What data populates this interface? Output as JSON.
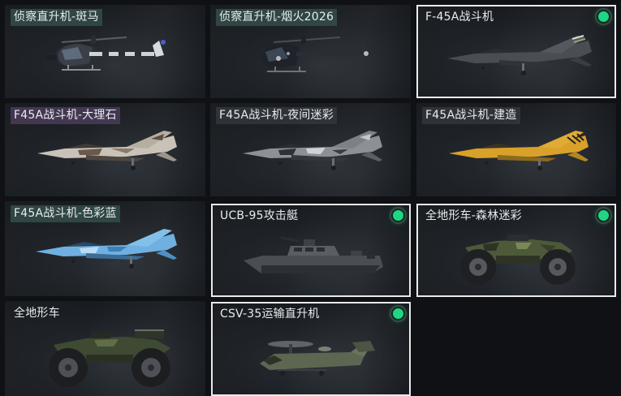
{
  "cards": [
    {
      "title": "侦察直升机-斑马",
      "selected": false,
      "equipped": false
    },
    {
      "title": "侦察直升机-烟火2026",
      "selected": false,
      "equipped": false
    },
    {
      "title": "F-45A战斗机",
      "selected": true,
      "equipped": true
    },
    {
      "title": "F45A战斗机-大理石",
      "selected": false,
      "equipped": false
    },
    {
      "title": "F45A战斗机-夜间迷彩",
      "selected": false,
      "equipped": false
    },
    {
      "title": "F45A战斗机-建造",
      "selected": false,
      "equipped": false
    },
    {
      "title": "F45A战斗机-色彩蓝",
      "selected": false,
      "equipped": false
    },
    {
      "title": "UCB-95攻击艇",
      "selected": true,
      "equipped": true
    },
    {
      "title": "全地形车-森林迷彩",
      "selected": true,
      "equipped": true
    },
    {
      "title": "全地形车",
      "selected": false,
      "equipped": false
    },
    {
      "title": "CSV-35运输直升机",
      "selected": true,
      "equipped": true
    }
  ],
  "icons": {
    "equipped": "equipped-dot-icon"
  },
  "colors": {
    "equipped_dot": "#1fd684",
    "selected_border": "#e8eaec",
    "background": "#0f1114"
  }
}
